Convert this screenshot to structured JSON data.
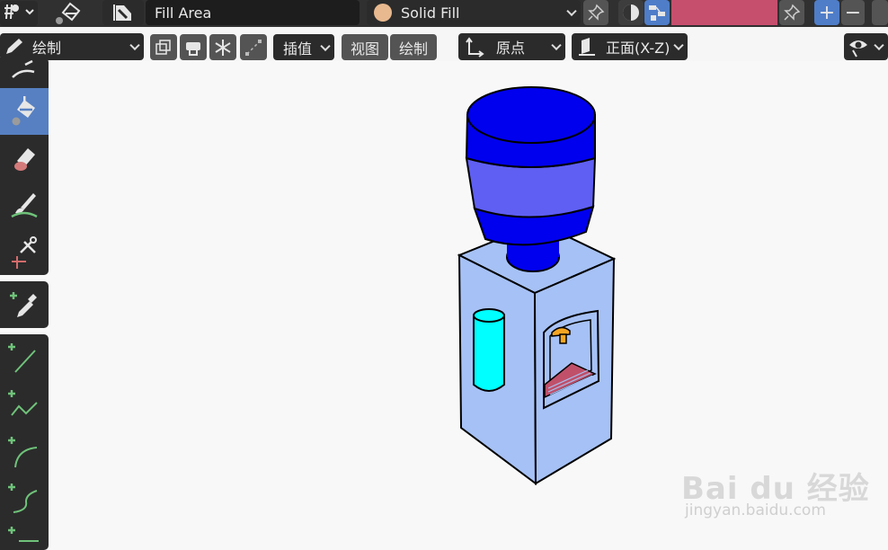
{
  "header": {
    "brush_name": "Fill Area",
    "material_name": "Solid Fill",
    "material_color": "#e8b98f",
    "slot_color": "#c64f6e"
  },
  "toolbar": {
    "mode_label": "绘制",
    "interpolate_label": "插值",
    "view_label": "视图",
    "draw_label": "绘制",
    "origin_label": "原点",
    "plane_label": "正面(X-Z)"
  },
  "tools": [
    {
      "name": "tool-draw",
      "icon": "draw-icon",
      "active": false
    },
    {
      "name": "tool-fill",
      "icon": "fill-bucket-icon",
      "active": true
    },
    {
      "name": "tool-erase",
      "icon": "eraser-icon",
      "active": false
    },
    {
      "name": "tool-tint",
      "icon": "tint-brush-icon",
      "active": false
    },
    {
      "name": "tool-cutter",
      "icon": "cutter-icon",
      "active": false
    },
    {
      "name": "tool-eyedropper",
      "icon": "eyedropper-icon",
      "active": false
    },
    {
      "name": "tool-line",
      "icon": "line-icon",
      "active": false
    },
    {
      "name": "tool-polyline",
      "icon": "polyline-icon",
      "active": false
    },
    {
      "name": "tool-arc",
      "icon": "arc-icon",
      "active": false
    },
    {
      "name": "tool-curve",
      "icon": "curve-icon",
      "active": false
    }
  ],
  "drawing": {
    "subject": "water-dispenser",
    "colors": {
      "bottle_dark": "#0000ee",
      "bottle_band": "#5f5ff4",
      "cabinet": "#a6c1f5",
      "tube": "#00ffff",
      "tap": "#f5a623",
      "tray": "#c0506a"
    }
  },
  "watermark": {
    "brand": "Bai du 经验",
    "url": "jingyan.baidu.com"
  }
}
